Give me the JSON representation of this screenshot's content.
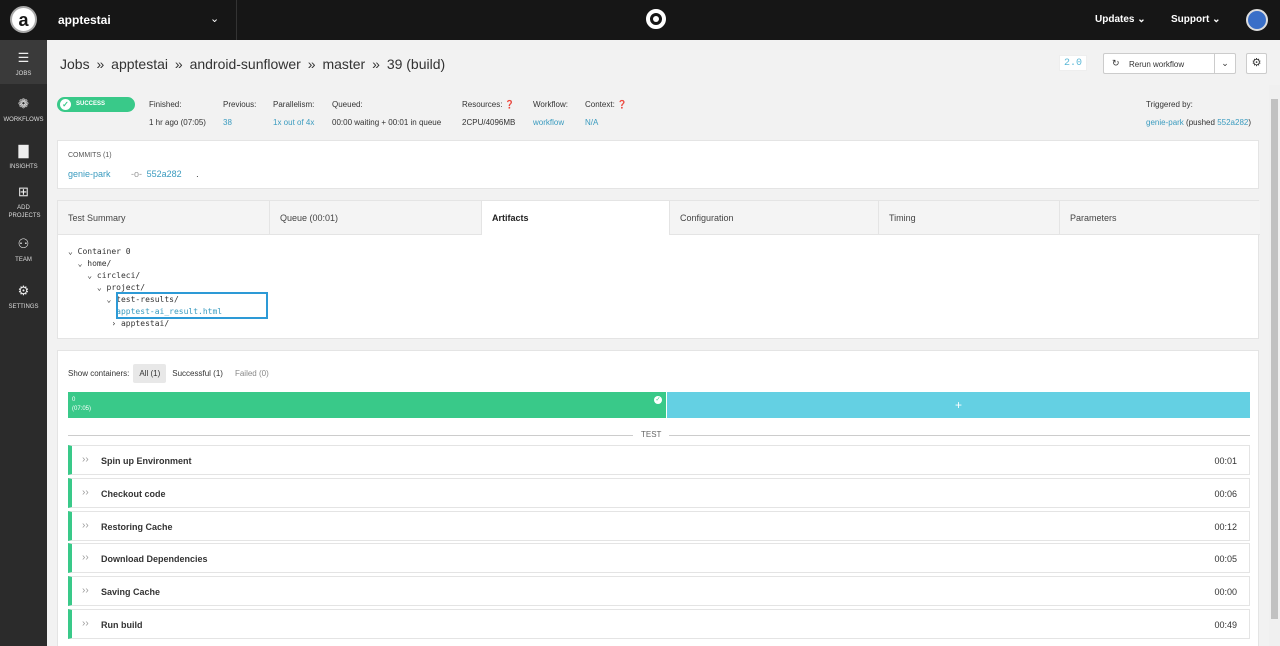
{
  "topbar": {
    "org_logo": "a",
    "org_name": "apptestai",
    "updates": "Updates",
    "support": "Support"
  },
  "sidebar": {
    "items": [
      {
        "icon": "jobs-icon",
        "label": "JOBS"
      },
      {
        "icon": "workflows-icon",
        "label": "WORKFLOWS"
      },
      {
        "icon": "insights-icon",
        "label": "INSIGHTS"
      },
      {
        "icon": "add-projects-icon",
        "label": "ADD PROJECTS"
      },
      {
        "icon": "team-icon",
        "label": "TEAM"
      },
      {
        "icon": "settings-icon",
        "label": "SETTINGS"
      }
    ]
  },
  "breadcrumb": [
    "Jobs",
    "»",
    "apptestai",
    "»",
    "android-sunflower",
    "»",
    "master",
    "»",
    "39 (build)"
  ],
  "version_badge": "2.0",
  "rerun_label": "Rerun workflow",
  "status": "SUCCESS",
  "meta": [
    {
      "key": "Finished:",
      "value": "1 hr ago (07:05)",
      "link": false
    },
    {
      "key": "Previous:",
      "value": "38",
      "link": true
    },
    {
      "key": "Parallelism:",
      "value": "1x out of 4x",
      "link": true
    },
    {
      "key": "Queued:",
      "value": "00:00 waiting + 00:01 in queue",
      "link": false
    },
    {
      "key": "Resources: ❓",
      "value": "2CPU/4096MB",
      "link": false
    },
    {
      "key": "Workflow:",
      "value": "workflow",
      "link": true
    },
    {
      "key": "Context: ❓",
      "value": "N/A",
      "link": true
    }
  ],
  "triggered": {
    "key": "Triggered by:",
    "user": "genie-park",
    "pushed": "(pushed",
    "commit": "552a282",
    "close": ")"
  },
  "commits": {
    "heading": "COMMITS (1)",
    "author": "genie-park",
    "hash": "552a282",
    "message": "."
  },
  "tabs": [
    "Test Summary",
    "Queue (00:01)",
    "Artifacts",
    "Configuration",
    "Timing",
    "Parameters"
  ],
  "tree": [
    "⌄ Container 0",
    "  ⌄ home/",
    "    ⌄ circleci/",
    "      ⌄ project/",
    "        ⌄ test-results/",
    "          apptest-ai_result.html",
    "         › apptestai/"
  ],
  "containers": {
    "label": "Show containers:",
    "all": "All (1)",
    "successful": "Successful (1)",
    "failed": "Failed (0)",
    "bar_index": "0",
    "bar_time": "(07:05)",
    "plus": "+"
  },
  "section_label": "TEST",
  "steps": [
    {
      "name": "Spin up Environment",
      "time": "00:01"
    },
    {
      "name": "Checkout code",
      "time": "00:06"
    },
    {
      "name": "Restoring Cache",
      "time": "00:12"
    },
    {
      "name": "Download Dependencies",
      "time": "00:05"
    },
    {
      "name": "Saving Cache",
      "time": "00:00"
    },
    {
      "name": "Run build",
      "time": "00:49"
    }
  ],
  "colors": {
    "success": "#39c989",
    "link": "#3a9bbf",
    "highlight": "#2d9ad6",
    "queued_bar": "#64d0e3"
  }
}
